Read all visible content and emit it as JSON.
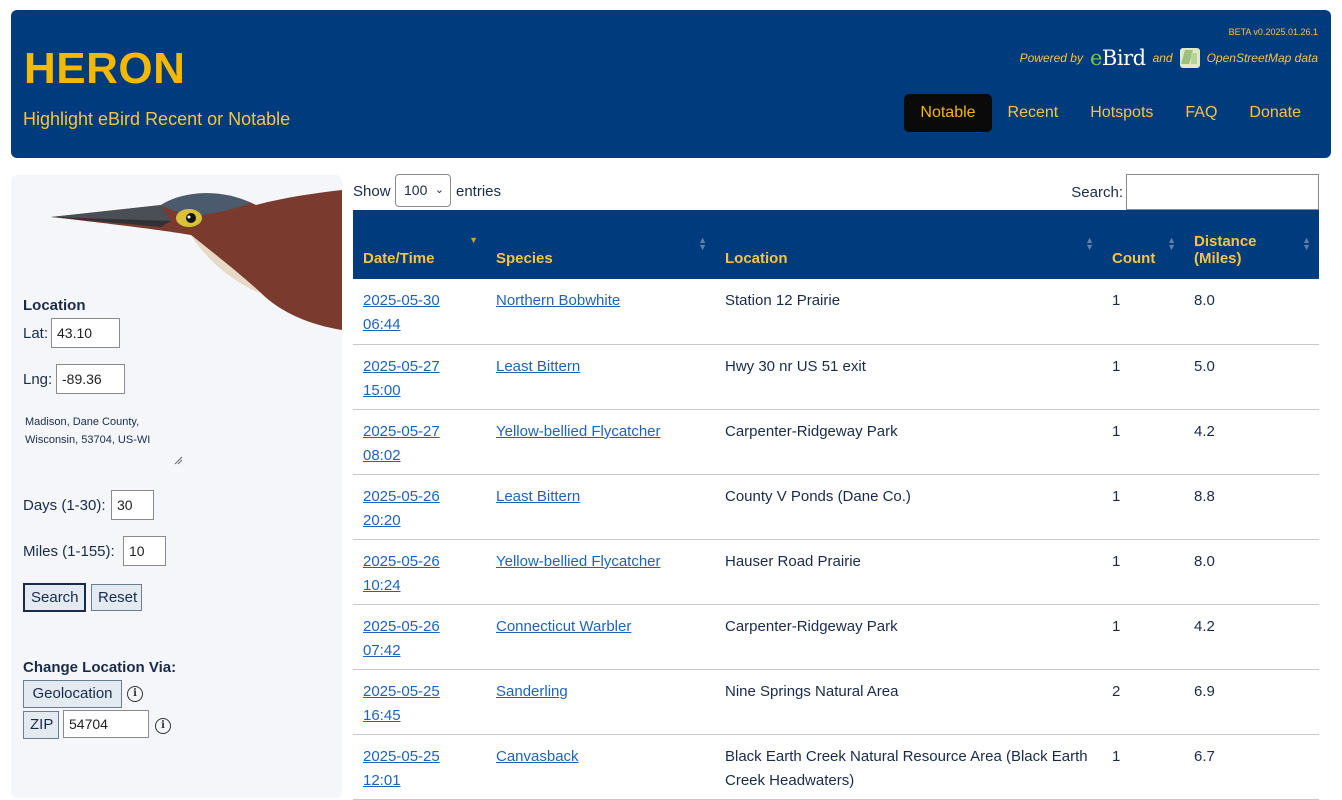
{
  "header": {
    "title": "HERON",
    "tagline": "Highlight eBird Recent or Notable",
    "version": "BETA v0.2025.01.26.1",
    "powered_by": "Powered by",
    "ebird_e": "e",
    "ebird_rest": "Bird",
    "and": "and",
    "osm": "OpenStreetMap data",
    "nav": [
      {
        "label": "Notable",
        "active": true
      },
      {
        "label": "Recent",
        "active": false
      },
      {
        "label": "Hotspots",
        "active": false
      },
      {
        "label": "FAQ",
        "active": false
      },
      {
        "label": "Donate",
        "active": false
      }
    ]
  },
  "sidebar": {
    "location_title": "Location",
    "lat_label": "Lat:",
    "lat_value": "43.10",
    "lng_label": "Lng:",
    "lng_value": "-89.36",
    "address_line1": "Madison, Dane County,",
    "address_line2": "Wisconsin, 53704, US-WI",
    "days_label": "Days (1-30):",
    "days_value": "30",
    "miles_label": "Miles (1-155):",
    "miles_value": "10",
    "search_button": "Search",
    "reset_button": "Reset",
    "change_title": "Change Location Via:",
    "geolocation_button": "Geolocation",
    "zip_button": "ZIP",
    "zip_value": "54704",
    "info_glyph": "i"
  },
  "controls": {
    "show_label": "Show",
    "page_size": "100",
    "caret": "⌄",
    "entries_label": "entries",
    "search_label": "Search:"
  },
  "table": {
    "columns": [
      "Date/Time",
      "Species",
      "Location",
      "Count",
      "Distance (Miles)"
    ],
    "distance_line1": "Distance",
    "distance_line2": "(Miles)",
    "rows": [
      {
        "date": "2025-05-30",
        "time": "06:44",
        "species": "Northern Bobwhite",
        "location": "Station 12 Prairie",
        "count": "1",
        "distance": "8.0"
      },
      {
        "date": "2025-05-27",
        "time": "15:00",
        "species": "Least Bittern",
        "location": "Hwy 30 nr US 51 exit",
        "count": "1",
        "distance": "5.0"
      },
      {
        "date": "2025-05-27",
        "time": "08:02",
        "species": "Yellow-bellied Flycatcher",
        "location": "Carpenter-Ridgeway Park",
        "count": "1",
        "distance": "4.2"
      },
      {
        "date": "2025-05-26",
        "time": "20:20",
        "species": "Least Bittern",
        "location": "County V Ponds (Dane Co.)",
        "count": "1",
        "distance": "8.8"
      },
      {
        "date": "2025-05-26",
        "time": "10:24",
        "species": "Yellow-bellied Flycatcher",
        "location": "Hauser Road Prairie",
        "count": "1",
        "distance": "8.0"
      },
      {
        "date": "2025-05-26",
        "time": "07:42",
        "species": "Connecticut Warbler",
        "location": "Carpenter-Ridgeway Park",
        "count": "1",
        "distance": "4.2"
      },
      {
        "date": "2025-05-25",
        "time": "16:45",
        "species": "Sanderling",
        "location": "Nine Springs Natural Area",
        "count": "2",
        "distance": "6.9"
      },
      {
        "date": "2025-05-25",
        "time": "12:01",
        "species": "Canvasback",
        "location": "Black Earth Creek Natural Resource Area (Black Earth Creek Headwaters)",
        "count": "1",
        "distance": "6.7"
      }
    ]
  },
  "colors": {
    "header_bg": "#003c7d",
    "accent_gold": "#f5b800",
    "link_blue": "#1f63b8"
  }
}
